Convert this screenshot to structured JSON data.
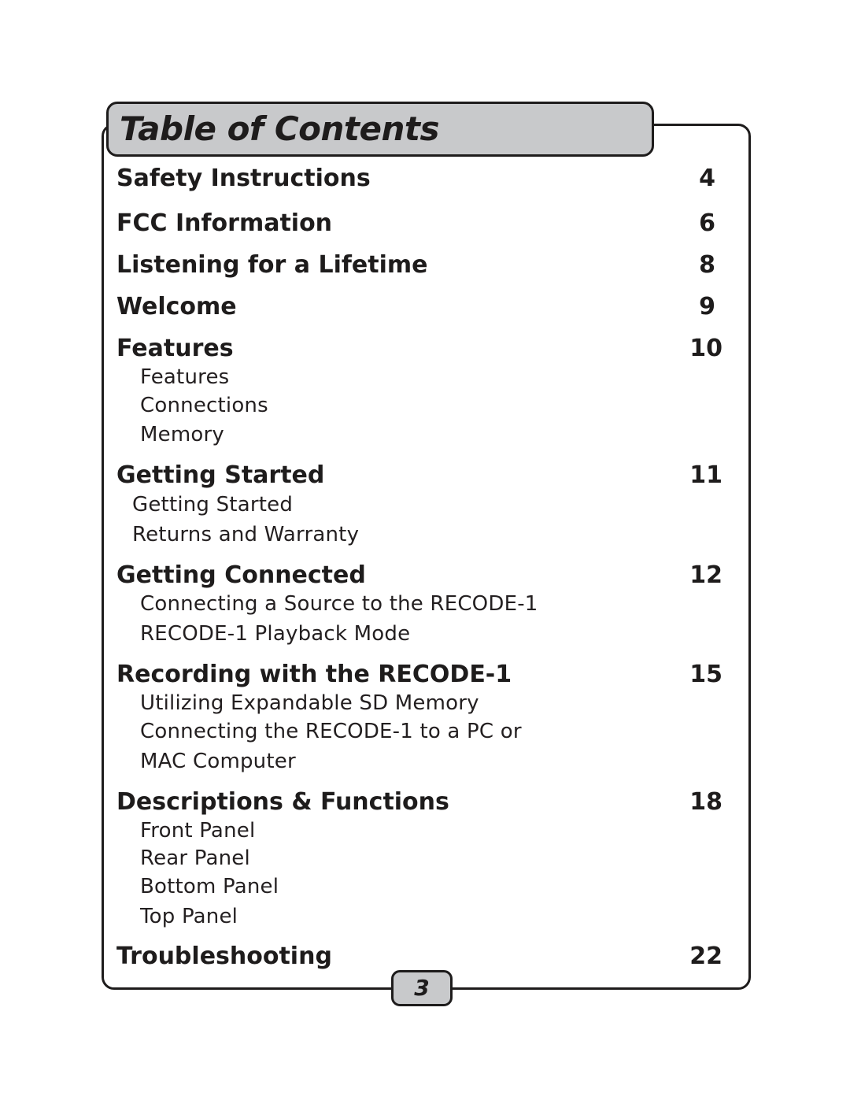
{
  "title": "Table of Contents",
  "page_number": "3",
  "entries": [
    {
      "label": "Safety Instructions",
      "page": "4",
      "subitems": []
    },
    {
      "label": "FCC Information",
      "page": "6",
      "subitems": []
    },
    {
      "label": "Listening for a Lifetime",
      "page": "8",
      "subitems": []
    },
    {
      "label": "Welcome",
      "page": "9",
      "subitems": []
    },
    {
      "label": "Features",
      "page": "10",
      "subitems": [
        "Features",
        "Connections",
        "Memory"
      ]
    },
    {
      "label": "Getting Started",
      "page": "11",
      "subitems": [
        "Getting Started",
        "Returns and Warranty"
      ]
    },
    {
      "label": "Getting Connected",
      "page": "12",
      "subitems": [
        "Connecting a Source to the RECODE-1",
        "RECODE-1 Playback Mode"
      ]
    },
    {
      "label": "Recording with the RECODE-1",
      "page": "15",
      "subitems": [
        "Utilizing Expandable SD Memory",
        "Connecting the RECODE-1 to a PC or",
        "MAC Computer"
      ]
    },
    {
      "label": "Descriptions & Functions",
      "page": "18",
      "subitems": [
        "Front Panel",
        "Rear Panel",
        "Bottom Panel",
        "Top Panel"
      ]
    },
    {
      "label": "Troubleshooting",
      "page": "22",
      "subitems": []
    }
  ]
}
